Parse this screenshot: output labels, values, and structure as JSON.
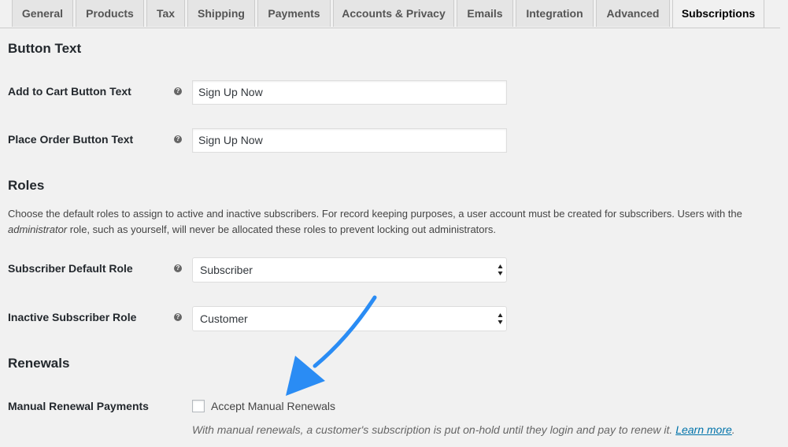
{
  "tabs": [
    {
      "label": "General"
    },
    {
      "label": "Products"
    },
    {
      "label": "Tax"
    },
    {
      "label": "Shipping"
    },
    {
      "label": "Payments"
    },
    {
      "label": "Accounts & Privacy"
    },
    {
      "label": "Emails"
    },
    {
      "label": "Integration"
    },
    {
      "label": "Advanced"
    },
    {
      "label": "Subscriptions"
    }
  ],
  "button_text": {
    "heading": "Button Text",
    "add_to_cart": {
      "label": "Add to Cart Button Text",
      "value": "Sign Up Now"
    },
    "place_order": {
      "label": "Place Order Button Text",
      "value": "Sign Up Now"
    }
  },
  "roles": {
    "heading": "Roles",
    "description_part1": "Choose the default roles to assign to active and inactive subscribers. For record keeping purposes, a user account must be created for subscribers. Users with the ",
    "description_em": "administrator",
    "description_part2": " role, such as yourself, will never be allocated these roles to prevent locking out administrators.",
    "default_role": {
      "label": "Subscriber Default Role",
      "value": "Subscriber"
    },
    "inactive_role": {
      "label": "Inactive Subscriber Role",
      "value": "Customer"
    }
  },
  "renewals": {
    "heading": "Renewals",
    "manual": {
      "label": "Manual Renewal Payments",
      "checkbox_label": "Accept Manual Renewals",
      "checked": false,
      "note": "With manual renewals, a customer's subscription is put on-hold until they login and pay to renew it. ",
      "link": "Learn more",
      "note_end": "."
    }
  },
  "help_glyph": "?",
  "colors": {
    "accent": "#0073aa",
    "arrow": "#2a8cf4",
    "background": "#f1f1f1"
  }
}
